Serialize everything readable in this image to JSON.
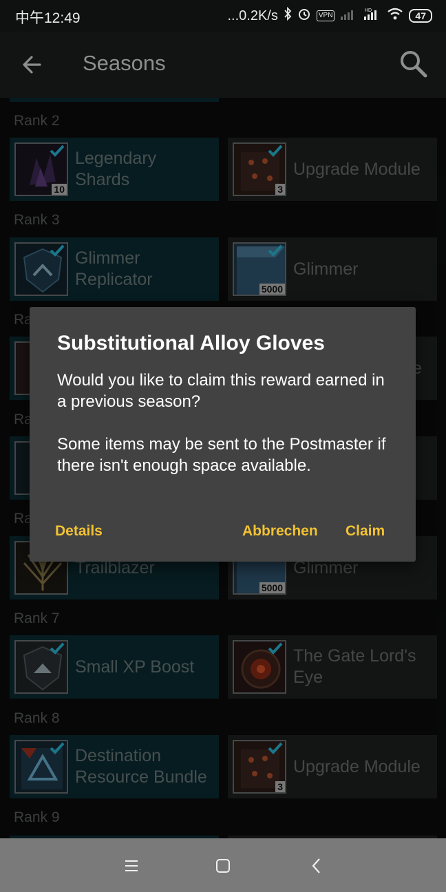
{
  "status_bar": {
    "time": "中午12:49",
    "network_speed": "...0.2K/s",
    "vpn": "VPN",
    "battery": "47"
  },
  "app_bar": {
    "title": "Seasons",
    "back_icon": "arrow-left-icon",
    "search_icon": "search-icon"
  },
  "ranks": [
    {
      "label": "Rank 2",
      "items": [
        {
          "name": "Legendary Shards",
          "qty": "10",
          "earned": true,
          "checked": true
        },
        {
          "name": "Upgrade Module",
          "qty": "3",
          "earned": false,
          "checked": true
        }
      ]
    },
    {
      "label": "Rank 3",
      "items": [
        {
          "name": "Glimmer Replicator",
          "qty": "",
          "earned": true,
          "checked": true
        },
        {
          "name": "Glimmer",
          "qty": "5000",
          "earned": false,
          "checked": true
        }
      ]
    },
    {
      "label": "Ra",
      "items": []
    },
    {
      "label": "Ra",
      "items": []
    },
    {
      "label": "Ra",
      "items": [
        {
          "name": "Trailblazer",
          "qty": "",
          "earned": true,
          "checked": false
        },
        {
          "name": "Glimmer",
          "qty": "5000",
          "earned": false,
          "checked": false
        }
      ]
    },
    {
      "label": "Rank 7",
      "items": [
        {
          "name": "Small XP Boost",
          "qty": "",
          "earned": true,
          "checked": true
        },
        {
          "name": "The Gate Lord's Eye",
          "qty": "",
          "earned": false,
          "checked": true
        }
      ]
    },
    {
      "label": "Rank 8",
      "items": [
        {
          "name": "Destination Resource Bundle",
          "qty": "",
          "earned": true,
          "checked": true
        },
        {
          "name": "Upgrade Module",
          "qty": "3",
          "earned": false,
          "checked": true
        }
      ]
    },
    {
      "label": "Rank 9",
      "items": []
    }
  ],
  "partial_text": {
    "cut_right_letter": "e"
  },
  "dialog": {
    "title": "Substitutional Alloy Gloves",
    "body_1": "Would you like to claim this reward earned in a previous season?",
    "body_2": "Some items may be sent to the Postmaster if there isn't enough space available.",
    "details_label": "Details",
    "cancel_label": "Abbrechen",
    "claim_label": "Claim"
  },
  "nav_bar": {
    "menu_icon": "menu-icon",
    "home_icon": "square-home-icon",
    "back_icon": "chevron-left-icon"
  },
  "colors": {
    "accent_button": "#f2c233",
    "earned_card": "#0c2b32",
    "unearned_card": "#1e2020",
    "dialog_bg": "#424242",
    "check": "#2ab7d6"
  }
}
